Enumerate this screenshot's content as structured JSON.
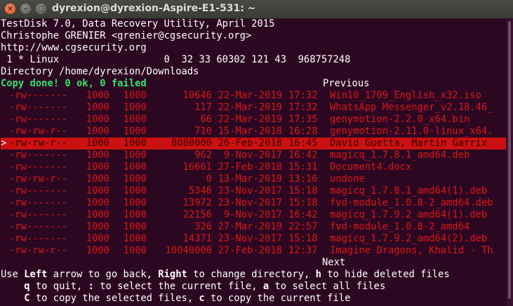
{
  "window": {
    "title": "dyrexion@dyrexion-Aspire-E1-531: ~"
  },
  "header": {
    "line1": "TestDisk 7.0, Data Recovery Utility, April 2015",
    "line2": "Christophe GRENIER <grenier@cgsecurity.org>",
    "line3": "http://www.cgsecurity.org",
    "line4": " 1 * Linux                  0  32 33 60302 121 43  968757248",
    "directory": "Directory /home/dyrexion/Downloads",
    "status": "Copy done! 0 ok, 0 failed",
    "previous": "Previous"
  },
  "files": [
    {
      "perm": "-rw-------",
      "uid": "1000",
      "gid": "1000",
      "size": "10646",
      "date": "22-Mar-2019",
      "time": "17:32",
      "name": "Win10_1709_English_x32.iso"
    },
    {
      "perm": "-rw-------",
      "uid": "1000",
      "gid": "1000",
      "size": "117",
      "date": "22-Mar-2019",
      "time": "17:32",
      "name": "WhatsApp Messenger_v2.18.46_"
    },
    {
      "perm": "-rw-------",
      "uid": "1000",
      "gid": "1000",
      "size": "66",
      "date": "22-Mar-2019",
      "time": "17:35",
      "name": "genymotion-2.2.0_x64.bin"
    },
    {
      "perm": "-rw-rw-r--",
      "uid": "1000",
      "gid": "1000",
      "size": "710",
      "date": "15-Mar-2018",
      "time": "16:28",
      "name": "genymotion-2.11.0-linux_x64."
    },
    {
      "perm": "-rw-rw-r--",
      "uid": "1000",
      "gid": "1000",
      "size": "8080000",
      "date": "26-Feb-2018",
      "time": "16:45",
      "name": "David Guetta, Martin Garrix",
      "selected": true
    },
    {
      "perm": "-rw-------",
      "uid": "1000",
      "gid": "1000",
      "size": "962",
      "date": "9-Nov-2017",
      "time": "16:42",
      "name": "magicq_1.7.8.1_amd64.deb"
    },
    {
      "perm": "-rw-------",
      "uid": "1000",
      "gid": "1000",
      "size": "16661",
      "date": "27-Feb-2018",
      "time": "15:31",
      "name": "Document4.docx"
    },
    {
      "perm": "-rw-rw-r--",
      "uid": "1000",
      "gid": "1000",
      "size": "0",
      "date": "13-Mar-2019",
      "time": "13:16",
      "name": "undone"
    },
    {
      "perm": "-rw-------",
      "uid": "1000",
      "gid": "1000",
      "size": "5346",
      "date": "23-Nov-2017",
      "time": "15:18",
      "name": "magicq_1.7.8.1_amd64(1).deb"
    },
    {
      "perm": "-rw-------",
      "uid": "1000",
      "gid": "1000",
      "size": "13972",
      "date": "23-Nov-2017",
      "time": "15:18",
      "name": "fvd-module_1.0.8-2_amd64.deb"
    },
    {
      "perm": "-rw-------",
      "uid": "1000",
      "gid": "1000",
      "size": "22156",
      "date": "9-Nov-2017",
      "time": "16:42",
      "name": "magicq_1.7.9.2_amd64(1).deb"
    },
    {
      "perm": "-rw-------",
      "uid": "1000",
      "gid": "1000",
      "size": "326",
      "date": "27-Mar-2019",
      "time": "22:57",
      "name": "fvd-module_1.0.8-2_amd64"
    },
    {
      "perm": "-rw-------",
      "uid": "1000",
      "gid": "1000",
      "size": "14371",
      "date": "23-Nov-2017",
      "time": "15:18",
      "name": "magicq_1.7.9.2_amd64(2).deb"
    },
    {
      "perm": "-rw-rw-r--",
      "uid": "1000",
      "gid": "1000",
      "size": "10040000",
      "date": "27-Feb-2018",
      "time": "12:37",
      "name": "Imagine Dragons, Khalid - Th"
    }
  ],
  "cursor": ">",
  "footer": {
    "next": "Next",
    "help1_a": "Use ",
    "help1_b": "Left",
    "help1_c": " arrow to go back, ",
    "help1_d": "Right",
    "help1_e": " to change directory, ",
    "help1_f": "h",
    "help1_g": " to hide deleted files",
    "help2_a": "    ",
    "help2_b": "q",
    "help2_c": " to quit, ",
    "help2_d": ":",
    "help2_e": " to select the current file, ",
    "help2_f": "a",
    "help2_g": " to select all files",
    "help3_a": "    ",
    "help3_b": "C",
    "help3_c": " to copy the selected files, ",
    "help3_d": "c",
    "help3_e": " to copy the current file"
  },
  "colors": {
    "background": "#2c0722",
    "deleted_file": "#d81818",
    "selection": "#cc1111",
    "status": "#33e36b"
  }
}
